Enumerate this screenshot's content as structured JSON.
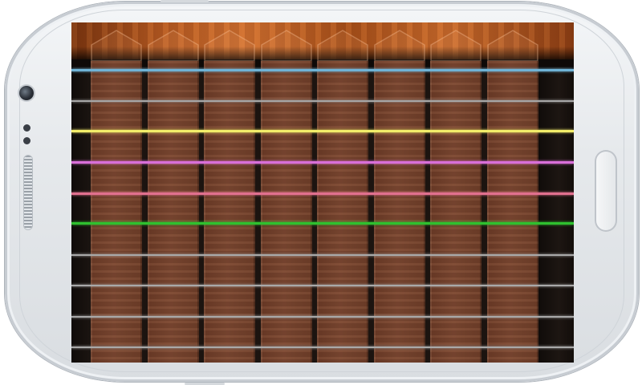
{
  "device": {
    "body_color": "#e6e9ec",
    "accent_color": "#3a3f46"
  },
  "app": {
    "wood_colors": {
      "headstock": "#b65a22",
      "fret": "#7a4630",
      "background": "#1c1410"
    },
    "fret_columns": [
      {
        "id": "fret-1"
      },
      {
        "id": "fret-2"
      },
      {
        "id": "fret-3"
      },
      {
        "id": "fret-4"
      },
      {
        "id": "fret-5"
      },
      {
        "id": "fret-6"
      },
      {
        "id": "fret-7"
      },
      {
        "id": "fret-8"
      }
    ],
    "strings": [
      {
        "name": "string-1",
        "color": "#6fb3d6"
      },
      {
        "name": "string-2",
        "color": "#a7a7a7"
      },
      {
        "name": "string-3",
        "color": "#f2ec6a"
      },
      {
        "name": "string-4",
        "color": "#d86fd8"
      },
      {
        "name": "string-5",
        "color": "#e0708e"
      },
      {
        "name": "string-6",
        "color": "#2fc02f"
      },
      {
        "name": "string-7",
        "color": "#a9a9a9"
      },
      {
        "name": "string-8",
        "color": "#a9a9a9"
      },
      {
        "name": "string-9",
        "color": "#a9a9a9"
      },
      {
        "name": "string-10",
        "color": "#a9a9a9"
      }
    ]
  }
}
